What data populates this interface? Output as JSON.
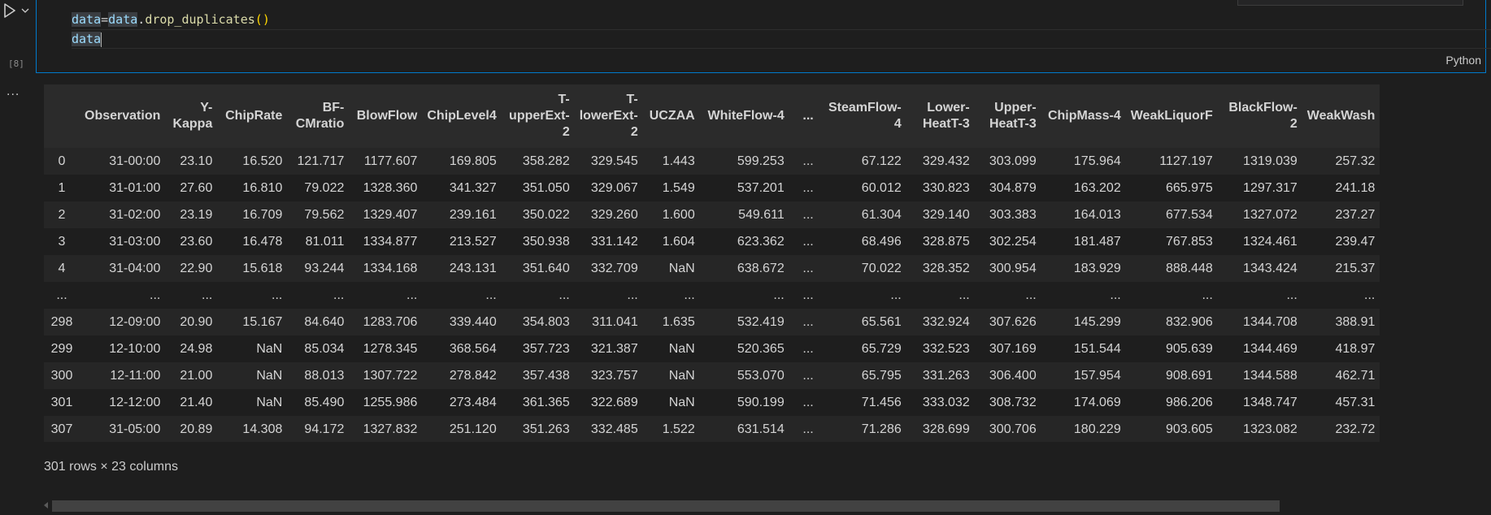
{
  "cell": {
    "execution_count": "[8]",
    "language": "Python",
    "code": {
      "line1": {
        "var1": "data",
        "op": "=",
        "var2": "data",
        "dot": ".",
        "fn": "drop_duplicates",
        "paren_open": "(",
        "paren_close": ")"
      },
      "line2": {
        "var": "data"
      }
    }
  },
  "output": {
    "menu_glyph": "...",
    "columns": [
      "",
      "Observation",
      "Y-Kappa",
      "ChipRate",
      "BF-CMratio",
      "BlowFlow",
      "ChipLevel4",
      "T-upperExt-2",
      "T-lowerExt-2",
      "UCZAA",
      "WhiteFlow-4",
      "...",
      "SteamFlow-4",
      "Lower-HeatT-3",
      "Upper-HeatT-3",
      "ChipMass-4",
      "WeakLiquorF",
      "BlackFlow-2",
      "WeakWash"
    ],
    "rows": [
      [
        "0",
        "31-00:00",
        "23.10",
        "16.520",
        "121.717",
        "1177.607",
        "169.805",
        "358.282",
        "329.545",
        "1.443",
        "599.253",
        "...",
        "67.122",
        "329.432",
        "303.099",
        "175.964",
        "1127.197",
        "1319.039",
        "257.32"
      ],
      [
        "1",
        "31-01:00",
        "27.60",
        "16.810",
        "79.022",
        "1328.360",
        "341.327",
        "351.050",
        "329.067",
        "1.549",
        "537.201",
        "...",
        "60.012",
        "330.823",
        "304.879",
        "163.202",
        "665.975",
        "1297.317",
        "241.18"
      ],
      [
        "2",
        "31-02:00",
        "23.19",
        "16.709",
        "79.562",
        "1329.407",
        "239.161",
        "350.022",
        "329.260",
        "1.600",
        "549.611",
        "...",
        "61.304",
        "329.140",
        "303.383",
        "164.013",
        "677.534",
        "1327.072",
        "237.27"
      ],
      [
        "3",
        "31-03:00",
        "23.60",
        "16.478",
        "81.011",
        "1334.877",
        "213.527",
        "350.938",
        "331.142",
        "1.604",
        "623.362",
        "...",
        "68.496",
        "328.875",
        "302.254",
        "181.487",
        "767.853",
        "1324.461",
        "239.47"
      ],
      [
        "4",
        "31-04:00",
        "22.90",
        "15.618",
        "93.244",
        "1334.168",
        "243.131",
        "351.640",
        "332.709",
        "NaN",
        "638.672",
        "...",
        "70.022",
        "328.352",
        "300.954",
        "183.929",
        "888.448",
        "1343.424",
        "215.37"
      ],
      [
        "...",
        "...",
        "...",
        "...",
        "...",
        "...",
        "...",
        "...",
        "...",
        "...",
        "...",
        "...",
        "...",
        "...",
        "...",
        "...",
        "...",
        "...",
        "..."
      ],
      [
        "298",
        "12-09:00",
        "20.90",
        "15.167",
        "84.640",
        "1283.706",
        "339.440",
        "354.803",
        "311.041",
        "1.635",
        "532.419",
        "...",
        "65.561",
        "332.924",
        "307.626",
        "145.299",
        "832.906",
        "1344.708",
        "388.91"
      ],
      [
        "299",
        "12-10:00",
        "24.98",
        "NaN",
        "85.034",
        "1278.345",
        "368.564",
        "357.723",
        "321.387",
        "NaN",
        "520.365",
        "...",
        "65.729",
        "332.523",
        "307.169",
        "151.544",
        "905.639",
        "1344.469",
        "418.97"
      ],
      [
        "300",
        "12-11:00",
        "21.00",
        "NaN",
        "88.013",
        "1307.722",
        "278.842",
        "357.438",
        "323.757",
        "NaN",
        "553.070",
        "...",
        "65.795",
        "331.263",
        "306.400",
        "157.954",
        "908.691",
        "1344.588",
        "462.71"
      ],
      [
        "301",
        "12-12:00",
        "21.40",
        "NaN",
        "85.490",
        "1255.986",
        "273.484",
        "361.365",
        "322.689",
        "NaN",
        "590.199",
        "...",
        "71.456",
        "333.032",
        "308.732",
        "174.069",
        "986.206",
        "1348.747",
        "457.31"
      ],
      [
        "307",
        "31-05:00",
        "20.89",
        "14.308",
        "94.172",
        "1327.832",
        "251.120",
        "351.263",
        "332.485",
        "1.522",
        "631.514",
        "...",
        "71.286",
        "328.699",
        "300.706",
        "180.229",
        "903.605",
        "1323.082",
        "232.72"
      ]
    ],
    "shape_text": "301 rows × 23 columns"
  },
  "colors": {
    "accent": "#007acc",
    "background": "#1e1e1e",
    "run_icon": "#cccccc"
  },
  "icons": {
    "run": "play-icon",
    "run_menu": "chevron-down-icon",
    "output_menu": "more-icon"
  }
}
